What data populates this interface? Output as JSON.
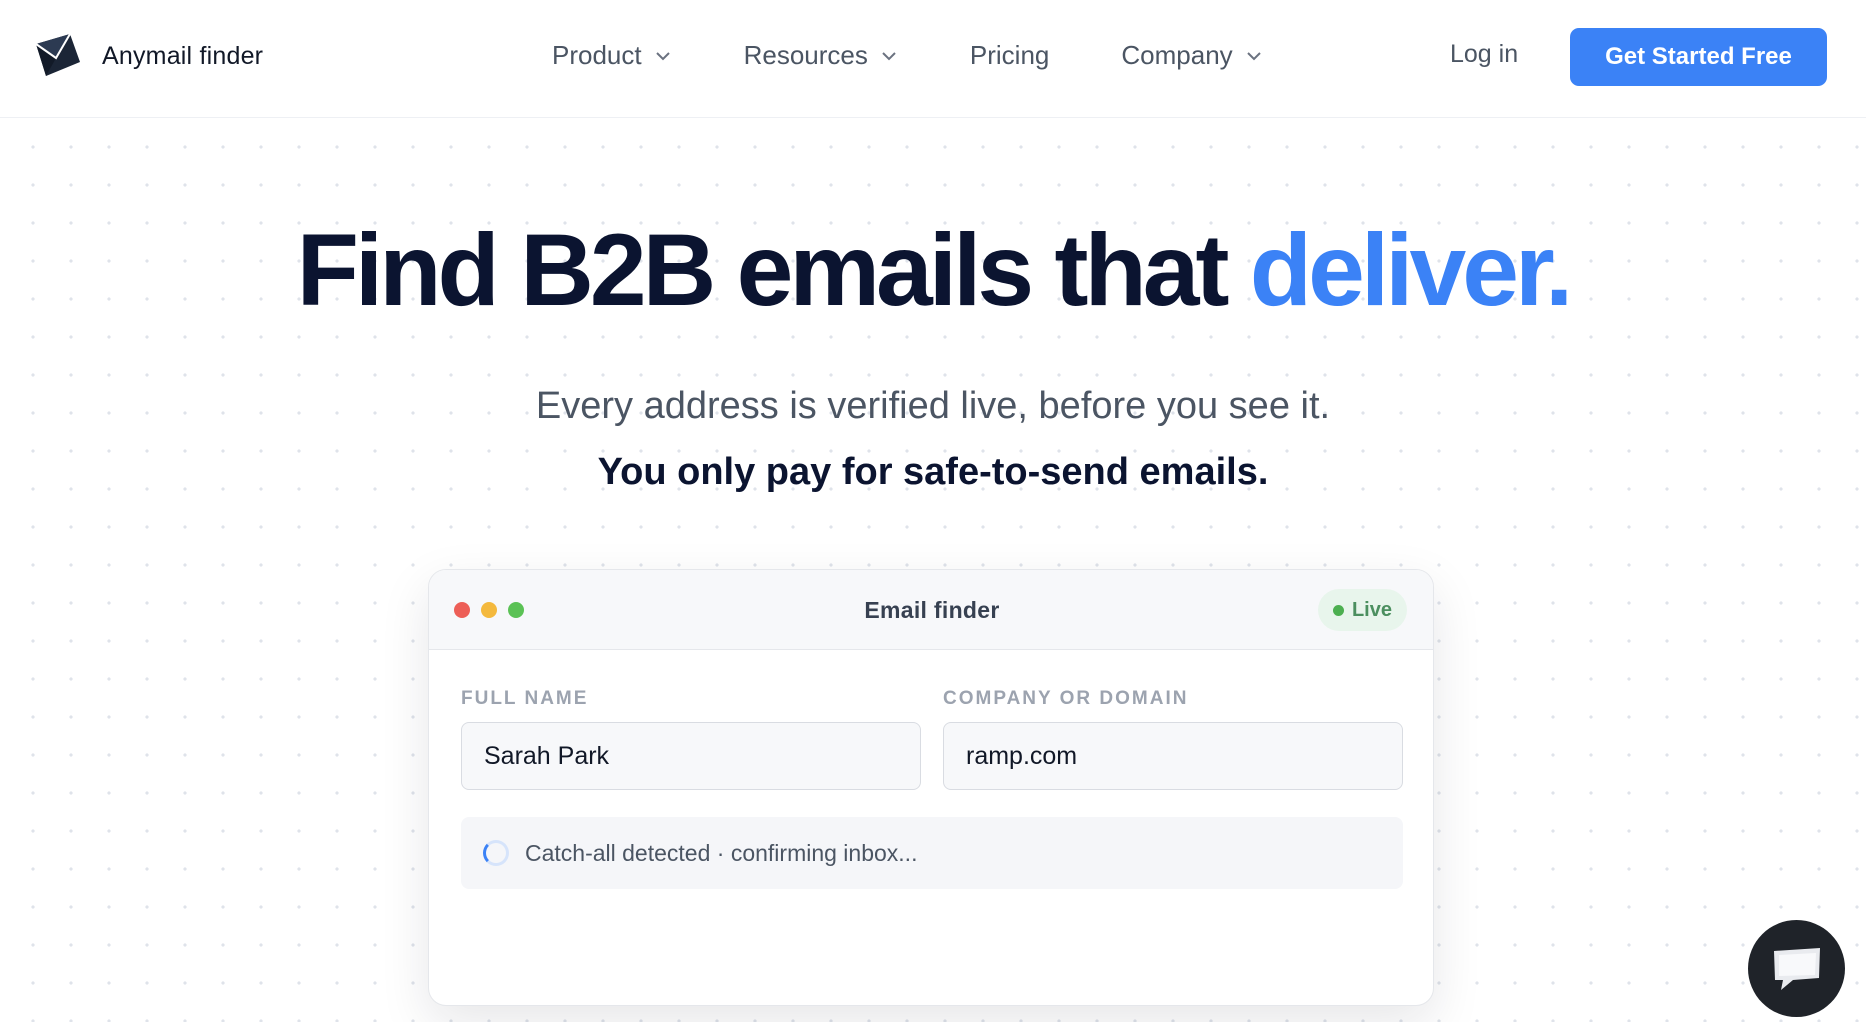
{
  "brand": {
    "name": "Anymail finder",
    "logo_icon": "envelope-logo-icon"
  },
  "nav": {
    "items": [
      {
        "label": "Product",
        "has_dropdown": true
      },
      {
        "label": "Resources",
        "has_dropdown": true
      },
      {
        "label": "Pricing",
        "has_dropdown": false
      },
      {
        "label": "Company",
        "has_dropdown": true
      }
    ],
    "login": "Log in",
    "cta": "Get Started Free"
  },
  "hero": {
    "title_main": "Find B2B emails that ",
    "title_accent": "deliver.",
    "subtitle_line1": "Every address is verified live, before you see it.",
    "subtitle_line2": "You only pay for safe-to-send emails."
  },
  "finder": {
    "window_title": "Email finder",
    "badge": "Live",
    "fields": [
      {
        "label": "FULL NAME",
        "value": "Sarah Park"
      },
      {
        "label": "COMPANY OR DOMAIN",
        "value": "ramp.com"
      }
    ],
    "status_text": "Catch-all detected · confirming inbox..."
  },
  "chat": {
    "icon": "chat-bubble-icon"
  },
  "colors": {
    "accent": "#3b82f6",
    "heading": "#0b1430",
    "live_badge_bg": "#e8f5ec",
    "live_dot": "#4caf50",
    "window_dot_red": "#ed5f57",
    "window_dot_yellow": "#f4b93d",
    "window_dot_green": "#5bc255"
  }
}
